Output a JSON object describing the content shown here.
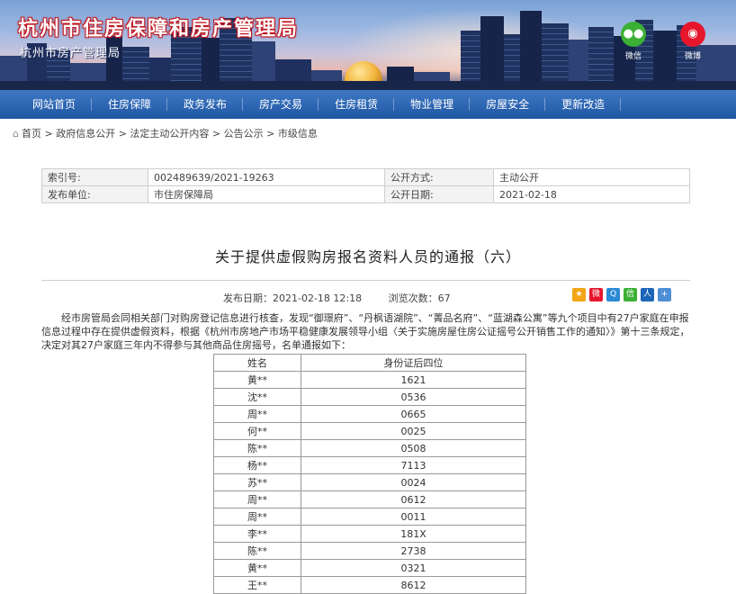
{
  "header": {
    "site_title": "杭州市住房保障和房产管理局",
    "site_subtitle": "杭州市房产管理局",
    "social": [
      {
        "name": "wechat-icon",
        "label": "微信",
        "color": "#3cb034"
      },
      {
        "name": "weibo-icon",
        "label": "微博",
        "color": "#e6162d"
      }
    ]
  },
  "nav": {
    "items": [
      "网站首页",
      "住房保障",
      "政务发布",
      "房产交易",
      "住房租赁",
      "物业管理",
      "房屋安全",
      "更新改造"
    ]
  },
  "breadcrumb": {
    "home_icon": "home-icon",
    "text": "首页 > 政府信息公开 > 法定主动公开内容 > 公告公示 > 市级信息"
  },
  "info_table": {
    "index_label": "索引号:",
    "index_value": "002489639/2021-19263",
    "method_label": "公开方式:",
    "method_value": "主动公开",
    "org_label": "发布单位:",
    "org_value": "市住房保障局",
    "date_label": "公开日期:",
    "date_value": "2021-02-18"
  },
  "article": {
    "title": "关于提供虚假购房报名资料人员的通报（六）",
    "publish_time": "发布日期：2021-02-18 12:18",
    "views": "浏览次数：67",
    "share_icons": [
      {
        "name": "qzone-icon",
        "color": "#f2a515",
        "glyph": "★"
      },
      {
        "name": "weibo-share-icon",
        "color": "#e6162d",
        "glyph": "微"
      },
      {
        "name": "qq-icon",
        "color": "#2a8ad4",
        "glyph": "Q"
      },
      {
        "name": "wechat-share-icon",
        "color": "#3cb034",
        "glyph": "信"
      },
      {
        "name": "renren-icon",
        "color": "#1b64b8",
        "glyph": "人"
      },
      {
        "name": "more-share-icon",
        "color": "#4e8fd6",
        "glyph": "+"
      }
    ],
    "body": "经市房管局会同相关部门对购房登记信息进行核查，发现“御璟府”、“丹枫语湖院”、“菁品名府”、“蓝湖森公寓”等九个项目中有27户家庭在申报信息过程中存在提供虚假资料，根据《杭州市房地产市场平稳健康发展领导小组〈关于实施房屋住房公证摇号公开销售工作的通知〉》第十三条规定，决定对其27户家庭三年内不得参与其他商品住房摇号，名单通报如下："
  },
  "names_table": {
    "headers": [
      "姓名",
      "身份证后四位"
    ],
    "rows": [
      [
        "黄**",
        "1621"
      ],
      [
        "沈**",
        "0536"
      ],
      [
        "周**",
        "0665"
      ],
      [
        "何**",
        "0025"
      ],
      [
        "陈**",
        "0508"
      ],
      [
        "杨**",
        "7113"
      ],
      [
        "苏**",
        "0024"
      ],
      [
        "周**",
        "0612"
      ],
      [
        "周**",
        "0011"
      ],
      [
        "李**",
        "181X"
      ],
      [
        "陈**",
        "2738"
      ],
      [
        "黄**",
        "0321"
      ],
      [
        "王**",
        "8612"
      ]
    ]
  }
}
